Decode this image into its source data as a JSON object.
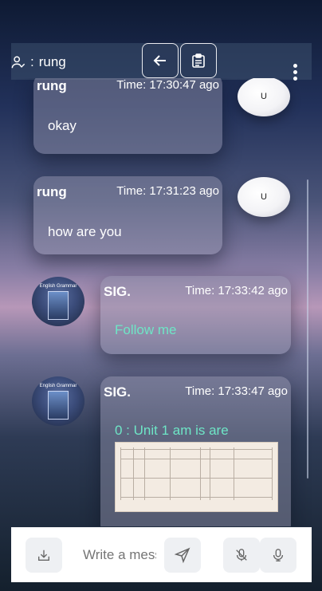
{
  "header": {
    "username": "rung",
    "user_prefix": ":",
    "back_icon": "arrow-left-icon",
    "notes_icon": "clipboard-icon",
    "menu_icon": "kebab-menu-icon"
  },
  "messages": [
    {
      "sender": "rung",
      "time": "Time: 17:30:47 ago",
      "text": "okay",
      "avatar": "U"
    },
    {
      "sender": "rung",
      "time": "Time: 17:31:23 ago",
      "text": "how are you",
      "avatar": "U"
    },
    {
      "sender": "SIG.",
      "time": "Time: 17:33:42 ago",
      "text": "Follow me",
      "avatar_title": "English Grammar"
    },
    {
      "sender": "SIG.",
      "time": "Time: 17:33:47 ago",
      "text": "0 : Unit 1 am is are",
      "avatar_title": "English Grammar"
    }
  ],
  "input": {
    "placeholder": "Write a message",
    "attach_icon": "download-tray-icon",
    "send_icon": "send-icon",
    "mic_off_icon": "mic-off-icon",
    "mic_icon": "mic-icon"
  },
  "colors": {
    "sig_text": "#6ee6c6",
    "bubble": "rgba(150,150,175,0.45)"
  }
}
